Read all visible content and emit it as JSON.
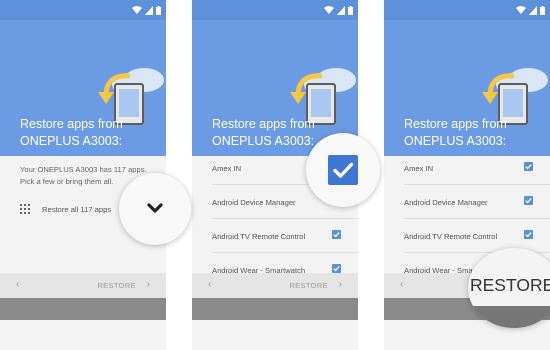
{
  "colors": {
    "header": "#6b9be2",
    "statusbar": "#5c90d8",
    "checkbox": "#5c90d8",
    "navbar": "#8a8a8a",
    "bottombar": "#e5e5e5"
  },
  "statusbar": {
    "icons": [
      "wifi-icon",
      "signal-icon",
      "battery-icon"
    ]
  },
  "header": {
    "title_line1": "Restore apps from",
    "title_line2": "ONEPLUS A3003:"
  },
  "step1": {
    "body_text": "Your ONEPLUS A3003 has 117 apps. Pick a few or bring them all.",
    "restore_all_label": "Restore all 117 apps"
  },
  "app_list": [
    {
      "name": "Amex IN",
      "checked": true
    },
    {
      "name": "Android Device Manager",
      "checked": false
    },
    {
      "name": "Android TV Remote Control",
      "checked": true
    },
    {
      "name": "Android Wear - Smartwatch",
      "checked": true
    }
  ],
  "app_list_panel3": [
    {
      "name": "Amex IN",
      "checked": true
    },
    {
      "name": "Android Device Manager",
      "checked": true
    },
    {
      "name": "Android TV Remote Control",
      "checked": true
    },
    {
      "name": "Android Wear - Smartwatch",
      "checked": true
    }
  ],
  "bottom": {
    "prev_glyph": "‹",
    "restore_label": "RESTORE",
    "next_glyph": "›"
  },
  "callouts": {
    "restore_label": "RESTORE"
  }
}
